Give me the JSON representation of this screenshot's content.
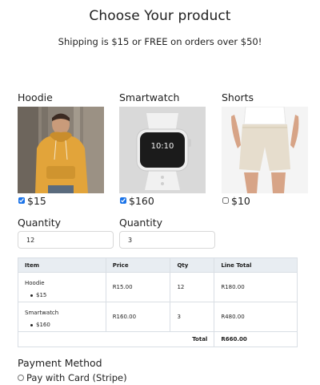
{
  "header": {
    "title": "Choose Your product",
    "subtitle": "Shipping is $15 or FREE on orders over $50!"
  },
  "products": [
    {
      "name": "Hoodie",
      "price": "$15",
      "checked": true,
      "image": "hoodie-photo"
    },
    {
      "name": "Smartwatch",
      "price": "$160",
      "checked": true,
      "image": "smartwatch-photo",
      "watch_time": "10:10"
    },
    {
      "name": "Shorts",
      "price": "$10",
      "checked": false,
      "image": "shorts-photo"
    }
  ],
  "quantities": [
    {
      "label": "Quantity",
      "value": "12"
    },
    {
      "label": "Quantity",
      "value": "3"
    }
  ],
  "table": {
    "headers": [
      "Item",
      "Price",
      "Qty",
      "Line Total"
    ],
    "rows": [
      {
        "item": "Hoodie",
        "sub": "$15",
        "price": "R15.00",
        "qty": "12",
        "total": "R180.00"
      },
      {
        "item": "Smartwatch",
        "sub": "$160",
        "price": "R160.00",
        "qty": "3",
        "total": "R480.00"
      }
    ],
    "total_label": "Total",
    "total_value": "R660.00"
  },
  "payment": {
    "title": "Payment Method",
    "option_label": "Pay with Card (Stripe)"
  },
  "colors": {
    "hoodie": "#e2a43a",
    "header_bg": "#e8edf2",
    "border": "#d9dee4",
    "checkbox": "#1a73e8"
  }
}
